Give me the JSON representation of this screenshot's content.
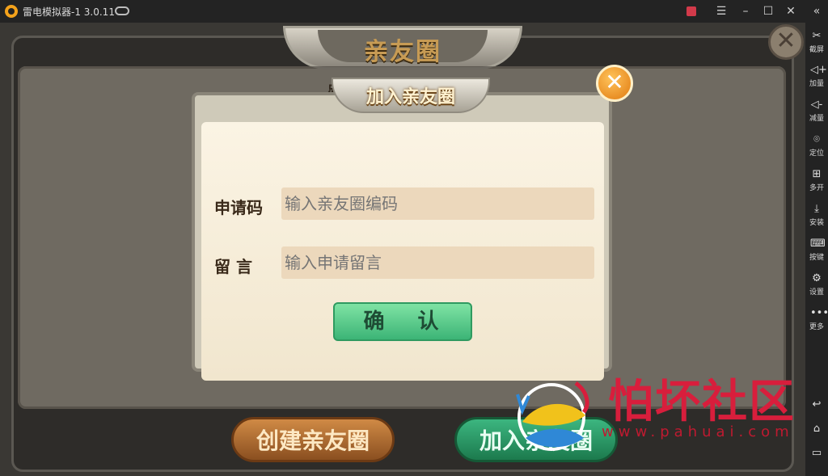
{
  "window": {
    "title": "雷电模拟器-1 3.0.11",
    "buttons": [
      "gift",
      "menu",
      "minimize",
      "maximize",
      "close"
    ]
  },
  "sidebar": {
    "collapse_icon": "«",
    "items": [
      {
        "icon": "scissors-icon",
        "glyph": "✂",
        "label": "截屏"
      },
      {
        "icon": "volume-up-icon",
        "glyph": "◁+",
        "label": "加量"
      },
      {
        "icon": "volume-down-icon",
        "glyph": "◁-",
        "label": "减量"
      },
      {
        "icon": "location-icon",
        "glyph": "⌾",
        "label": "定位"
      },
      {
        "icon": "multi-open-icon",
        "glyph": "⊞",
        "label": "多开"
      },
      {
        "icon": "install-apk-icon",
        "glyph": "⤓",
        "label": "安装"
      },
      {
        "icon": "keyboard-icon",
        "glyph": "⌨",
        "label": "按键"
      },
      {
        "icon": "settings-icon",
        "glyph": "⚙",
        "label": "设置"
      },
      {
        "icon": "more-icon",
        "glyph": "•••",
        "label": "更多"
      }
    ],
    "nav": [
      {
        "icon": "back-icon",
        "glyph": "↩"
      },
      {
        "icon": "home-icon",
        "glyph": "⌂"
      },
      {
        "icon": "recent-apps-icon",
        "glyph": "▭"
      }
    ]
  },
  "game": {
    "title": "亲友圈",
    "hint": "点击对应亲友圈即可进入",
    "create_button": "创建亲友圈",
    "join_button": "加入亲友圈",
    "modal": {
      "title": "加入亲友圈",
      "code_label": "申请码",
      "code_placeholder": "输入亲友圈编码",
      "message_label": "留 言",
      "message_placeholder": "输入申请留言",
      "confirm": "确 认"
    }
  },
  "watermark": {
    "text": "怕坏社区",
    "url": "www.pahuai.com"
  }
}
